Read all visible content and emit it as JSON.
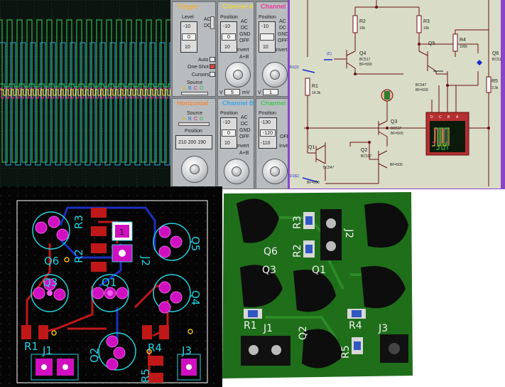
{
  "oscilloscope": {
    "trigger": {
      "title": "Trigger",
      "level_label": "Level",
      "level_value": "0",
      "spin_top": "-10",
      "spin_bottom": "10",
      "ac": "AC",
      "dc": "DC",
      "auto": "Auto",
      "one_shot": "One-Shot",
      "cursors": "Cursors",
      "source": "Source",
      "src_a": "A",
      "src_b": "B",
      "src_c": "C",
      "src_d": "D"
    },
    "channel_a": {
      "title": "Channel A",
      "position": "Position",
      "spin_top": "-10",
      "spin_mid": "0",
      "spin_bottom": "10",
      "ac": "AC",
      "dc": "DC",
      "gnd": "GND",
      "off": "OFF",
      "invert": "Invert",
      "apb": "A+B",
      "v": "V",
      "value": "5",
      "unit": "mV"
    },
    "channel_c": {
      "title": "Channel",
      "position": "Position",
      "spin_top": "-10",
      "spin_bottom": "10",
      "ac": "AC",
      "dc": "DC",
      "gnd": "GND",
      "off": "OFF",
      "invert": "Invert",
      "v": "V",
      "value": "1"
    },
    "horizontal": {
      "title": "Horizontal",
      "source": "Source",
      "position": "Position",
      "src_a": "A",
      "src_b": "B",
      "src_c": "C",
      "src_d": "D",
      "position_values": "210 200 190"
    },
    "channel_b": {
      "title": "Channel B",
      "position": "Position",
      "spin_top": "-10",
      "spin_mid": "0",
      "spin_bottom": "10",
      "ac": "AC",
      "dc": "DC",
      "gnd": "GND",
      "off": "OFF",
      "invert": "Invert",
      "apb": "A+B"
    },
    "channel_d": {
      "title": "Channel",
      "position": "Position",
      "spin_top": "-130",
      "spin_mid": "-120",
      "spin_bottom": "-110",
      "off": "OFF",
      "invert": "Invert"
    },
    "trace_colors": {
      "a": "#f0e64a",
      "b": "#2fa8e0",
      "c": "#e0288c",
      "d": "#3cd25a"
    }
  },
  "schematic": {
    "r1": {
      "ref": "R1",
      "value": "14.3k"
    },
    "r2": {
      "ref": "R2",
      "value": "10k"
    },
    "r3": {
      "ref": "R3",
      "value": "10k"
    },
    "r4": {
      "ref": "R4",
      "value": "100k"
    },
    "r5": {
      "ref": "R5",
      "value": "3.3k"
    },
    "q1": {
      "ref": "Q1",
      "type": "BC547",
      "bf": "BF=500"
    },
    "q2": {
      "ref": "Q2",
      "type": "BC517",
      "bf": "BF=500"
    },
    "q3": {
      "ref": "Q3",
      "type": "BC517",
      "bf": "BF=500"
    },
    "q4": {
      "ref": "Q4",
      "type": "BC517",
      "bf": "BF=500"
    },
    "q5": {
      "ref": "Q5"
    },
    "q6": {
      "ref": "Q6",
      "type": "BC517"
    },
    "q4b": {
      "type": "BC547",
      "bf": "BF=500"
    },
    "net_c": "(C)",
    "net_r1": "R1(2)",
    "net_d": "D1(E)",
    "net_bf": "BF=500",
    "scope_pins": [
      "A",
      "B",
      "C",
      "D"
    ]
  },
  "pcb": {
    "r3": "R3",
    "r2": "R2",
    "r1": "R1",
    "r4": "R4",
    "r5": "R5",
    "q1": "Q1",
    "q2": "Q2",
    "q3": "Q3",
    "q4": "Q4",
    "q5": "Q5",
    "q6": "Q6",
    "j1": "J1",
    "j2": "J2",
    "j3": "J3",
    "pin1": "1"
  },
  "pcb3d": {
    "r3": "R3",
    "r2": "R2",
    "r1": "R1",
    "r4": "R4",
    "r5": "R5",
    "q1": "Q1",
    "q2": "Q2",
    "q3": "Q3",
    "q6": "Q6",
    "j1": "J1",
    "j2": "J2",
    "j3": "J3"
  }
}
